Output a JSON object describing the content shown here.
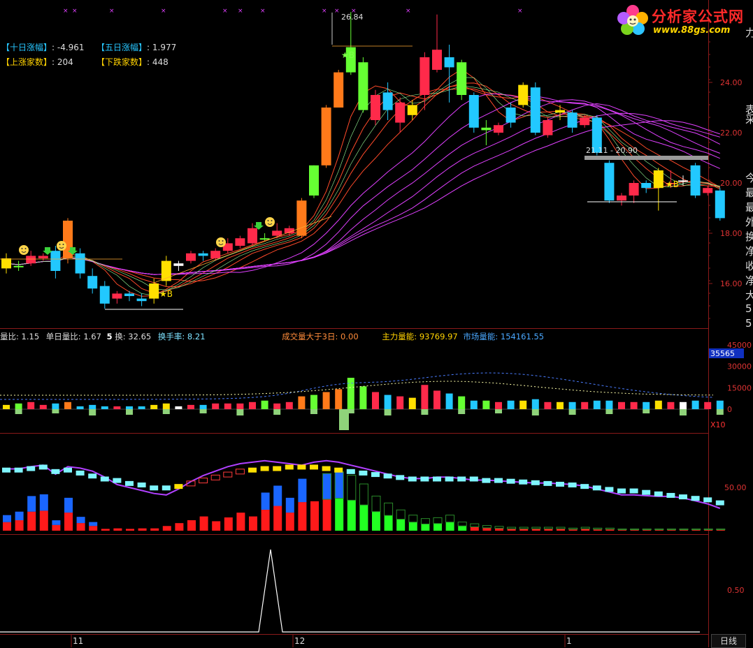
{
  "info_panel": {
    "ten_day_label": "【十日涨幅】",
    "ten_day_value": ": -4.961",
    "five_day_label": "【五日涨幅】",
    "five_day_value": ": 1.977",
    "up_label": "【上涨家数】",
    "up_value": ": 204",
    "down_label": "【下跌家数】",
    "down_value": ": 448"
  },
  "logo": {
    "title": "分析家公式网",
    "url": "www.88gs.com"
  },
  "price_panel": {
    "high_marker": "26.84",
    "low_range_marker": "21.11 - 20.90",
    "y_ticks": [
      "24.00",
      "22.00",
      "20.00",
      "18.00",
      "16.00"
    ],
    "star_labels": [
      "★B",
      "★B",
      "★B"
    ]
  },
  "volume_info": {
    "ratio_label": "量比:",
    "ratio_value": "1.15",
    "single_ratio_label": "单日量比:",
    "single_ratio_value": "1.67",
    "num5": "5",
    "swap_label": "换:",
    "swap_value": "32.65",
    "turnover_label": "换手率:",
    "turnover_value": "8.21",
    "vol_gt_label": "成交量大于3日:",
    "vol_gt_value": "0.00",
    "main_energy_label": "主力量能:",
    "main_energy_value": "93769.97",
    "market_energy_label": "市场量能:",
    "market_energy_value": "154161.55"
  },
  "volume_panel": {
    "y_ticks": [
      "45000",
      "30000",
      "15000",
      "0"
    ],
    "current_box": "35565",
    "multiplier": "X10"
  },
  "indicator_panel": {
    "y_ticks": [
      "50.00"
    ]
  },
  "signal_panel": {
    "y_ticks": [
      "0.50"
    ]
  },
  "x_axis": {
    "labels": [
      "11",
      "12",
      "1"
    ],
    "period_button": "日线"
  },
  "right_edge": {
    "chars_top": [
      "力",
      "表",
      "采"
    ],
    "chars_mid": [
      "今",
      "最",
      "最",
      "外",
      "换",
      "净",
      "收",
      "净",
      "大",
      "5",
      "5"
    ]
  },
  "colors": {
    "up": "#ff2a4a",
    "down": "#22c8ff",
    "orange": "#ff7a1a",
    "yellow": "#ffe000",
    "green": "#66ff33",
    "magenta": "#e040ff",
    "grid": "#8b1a1a"
  }
}
